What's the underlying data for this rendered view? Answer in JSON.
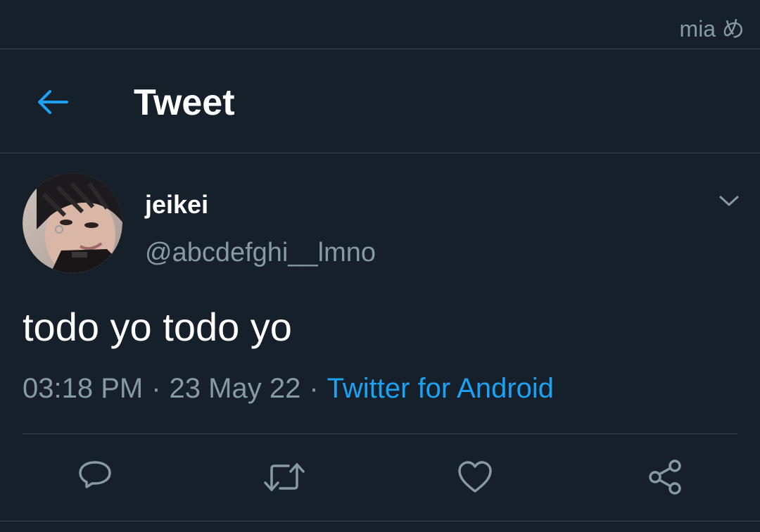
{
  "status_bar": {
    "text": "mia め"
  },
  "header": {
    "title": "Tweet",
    "back_icon": "arrow-left-icon",
    "accent": "#1da1f2"
  },
  "tweet": {
    "display_name": "jeikei",
    "handle": "@abcdefghi__lmno",
    "text": "todo yo todo yo",
    "time": "03:18 PM",
    "date": "23 May 22",
    "separator": "·",
    "source": "Twitter for Android",
    "caret_icon": "chevron-down-icon",
    "avatar_icon": "avatar-photo"
  },
  "actions": [
    {
      "name": "reply",
      "icon": "reply-icon"
    },
    {
      "name": "retweet",
      "icon": "retweet-icon"
    },
    {
      "name": "like",
      "icon": "heart-icon"
    },
    {
      "name": "share",
      "icon": "share-icon"
    }
  ],
  "colors": {
    "background": "#15202b",
    "text_primary": "#ffffff",
    "text_secondary": "#8899a6",
    "link": "#1da1f2",
    "border": "#38444d"
  }
}
